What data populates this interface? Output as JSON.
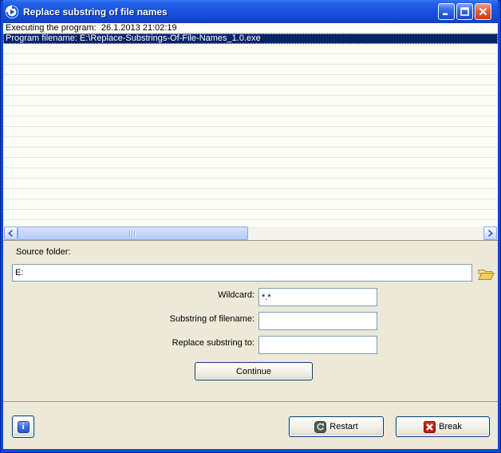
{
  "window": {
    "title": "Replace substring of file names",
    "controls": {
      "minimize": "minimize",
      "maximize": "maximize",
      "close": "close"
    }
  },
  "log": {
    "rows": [
      {
        "text": "Executing the program:  26.1.2013 21:02:19",
        "selected": false
      },
      {
        "text": "Program filename: E:\\Replace-Substrings-Of-File-Names_1.0.exe",
        "selected": true
      }
    ]
  },
  "form": {
    "source_folder": {
      "label": "Source folder:",
      "value": "E:"
    },
    "wildcard": {
      "label": "Wildcard:",
      "value": "*.*"
    },
    "substring": {
      "label": "Substring of filename:",
      "value": ""
    },
    "replace": {
      "label": "Replace substring to:",
      "value": ""
    },
    "continue_label": "Continue"
  },
  "footer": {
    "restart_label": "Restart",
    "break_label": "Break"
  },
  "icons": {
    "window_icon": "run-circle-arrow",
    "folder_icon": "open-folder-yellow",
    "info_icon": "info-blue-square",
    "restart_icon": "circular-arrow-dark",
    "break_icon": "red-square-white-x"
  },
  "colors": {
    "frame_blue": "#0c49d8",
    "titlebar_mid": "#1b53dd",
    "selection_navy": "#0a246a",
    "client_beige": "#ece9d8",
    "input_border": "#7f9db9",
    "button_border": "#003c74",
    "scroll_thumb": "#c8d8fb"
  }
}
